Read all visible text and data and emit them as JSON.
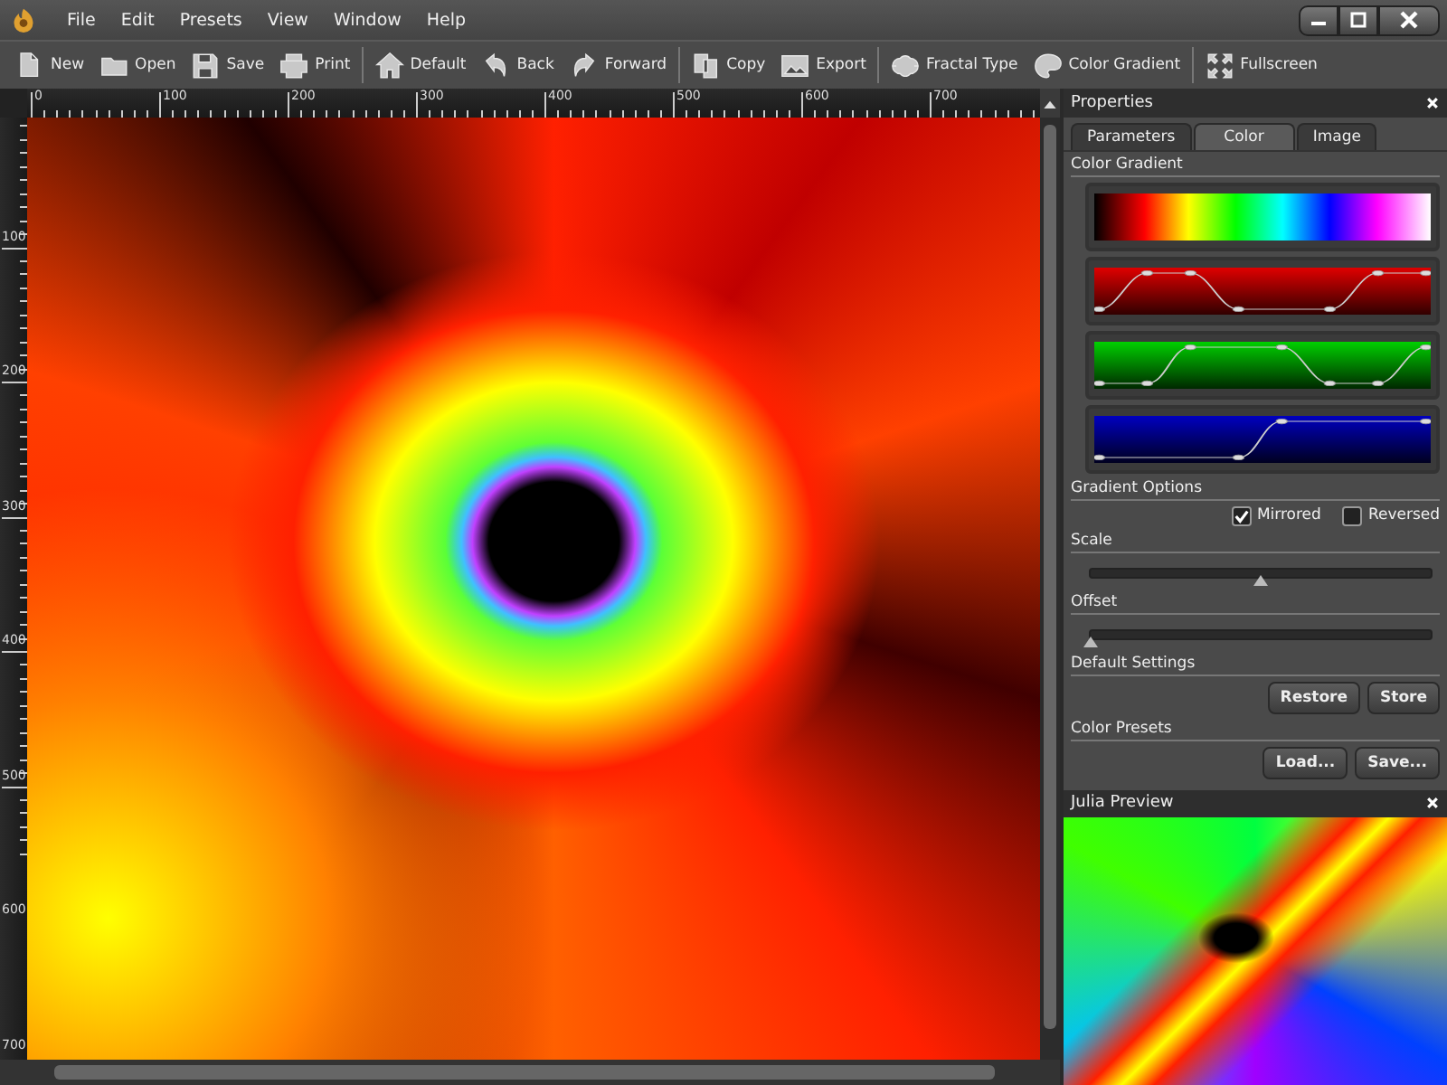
{
  "menu": [
    "File",
    "Edit",
    "Presets",
    "View",
    "Window",
    "Help"
  ],
  "toolbar": [
    [
      "New",
      "Open",
      "Save",
      "Print"
    ],
    [
      "Default",
      "Back",
      "Forward"
    ],
    [
      "Copy",
      "Export"
    ],
    [
      "Fractal Type",
      "Color Gradient"
    ],
    [
      "Fullscreen"
    ]
  ],
  "ruler": {
    "horizontal": [
      "0",
      "100",
      "200",
      "300",
      "400",
      "500",
      "600",
      "700"
    ],
    "vertical": [
      "100",
      "200",
      "300",
      "400",
      "500",
      "600",
      "700"
    ]
  },
  "properties": {
    "title": "Properties",
    "tabs": [
      {
        "label": "Parameters",
        "selected": false
      },
      {
        "label": "Color",
        "selected": true
      },
      {
        "label": "Image",
        "selected": false
      }
    ],
    "color_gradient_label": "Color Gradient",
    "gradient_options_label": "Gradient Options",
    "checkboxes": [
      {
        "label": "Mirrored",
        "checked": true
      },
      {
        "label": "Reversed",
        "checked": false
      }
    ],
    "sliders": [
      {
        "label": "Scale",
        "level": 0.5
      },
      {
        "label": "Offset",
        "level": 0
      }
    ],
    "default_settings": {
      "label": "Default Settings",
      "buttons": [
        "Restore",
        "Store"
      ]
    },
    "color_presets": {
      "label": "Color Presets",
      "buttons": [
        "Load...",
        "Save..."
      ]
    }
  },
  "julia_preview": {
    "title": "Julia Preview"
  }
}
